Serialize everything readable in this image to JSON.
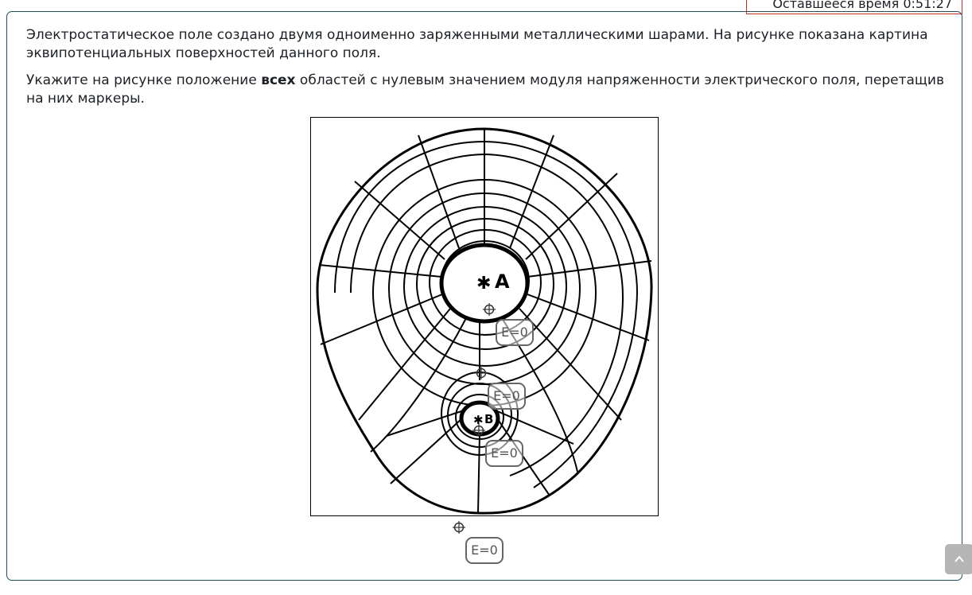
{
  "timer": {
    "text": "Оставшееся время 0:51:27"
  },
  "question": {
    "paragraph1": "Электростатическое поле создано двумя одноименно заряженными металлическими шарами. На рисунке показана картина эквипотенциальных поверхностей данного поля.",
    "paragraph2_before": "Укажите на рисунке положение ",
    "paragraph2_bold": "всех",
    "paragraph2_after": " областей с нулевым значением модуля напряженности электрического поля, перетащив на них маркеры."
  },
  "figure": {
    "label_a": "A",
    "label_b": "B"
  },
  "markers": [
    {
      "label": "E=0"
    },
    {
      "label": "E=0"
    },
    {
      "label": "E=0"
    },
    {
      "label": "E=0"
    }
  ],
  "icons": {
    "scroll_top": "arrow-up-icon",
    "marker_target": "crosshair-icon"
  }
}
